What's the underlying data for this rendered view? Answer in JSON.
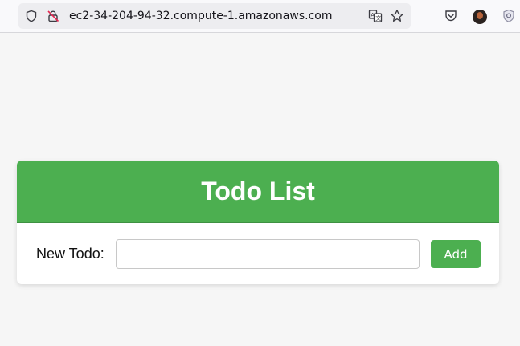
{
  "browser": {
    "url": "ec2-34-204-94-32.compute-1.amazonaws.com",
    "icons": [
      "shield-icon",
      "insecure-lock-icon",
      "translate-icon",
      "bookmark-star-icon",
      "pocket-icon",
      "account-avatar",
      "extension-icon"
    ]
  },
  "app": {
    "title": "Todo List",
    "new_todo_label": "New Todo:",
    "input_value": "",
    "add_button_label": "Add",
    "colors": {
      "accent": "#4caf50",
      "background": "#f6f6f6",
      "card": "#ffffff"
    }
  }
}
